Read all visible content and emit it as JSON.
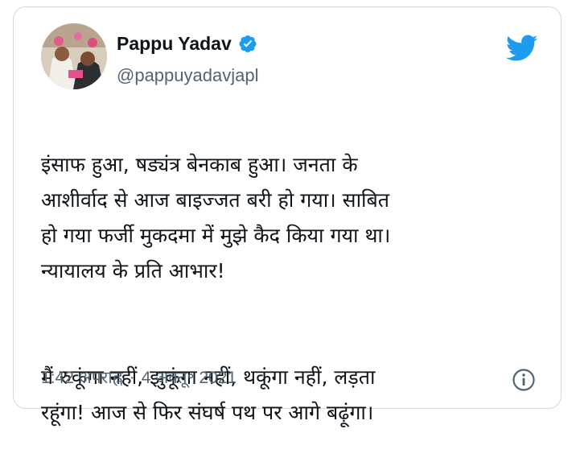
{
  "tweet": {
    "author": {
      "display_name": "Pappu Yadav",
      "handle": "@pappuyadavjapl",
      "verified_icon": "verified-badge-icon",
      "avatar_icon": "profile-photo"
    },
    "platform_icon": "twitter-bird-icon",
    "paragraphs": [
      "इंसाफ हुआ, षड्यंत्र बेनकाब हुआ। जनता के\nआशीर्वाद से आज बाइज्जत बरी हो गया। साबित\nहो गया फर्जी मुकदमा में मुझे कैद किया गया था।\nन्यायालय के प्रति आभार!",
      "मैं रुकूंगा नहीं, झुकूंगा नहीं, थकूंगा नहीं, लड़ता\nरहूंगा! आज से फिर संघर्ष पथ पर आगे बढ़ूंगा।"
    ],
    "time": "1:42 अपराह्न",
    "separator": "·",
    "date": "4 अक्तू॰ 2021",
    "info_icon": "info-icon"
  },
  "colors": {
    "accent": "#1d9bf0",
    "text": "#0f1419",
    "secondary": "#536471",
    "border": "#cfd9de"
  }
}
